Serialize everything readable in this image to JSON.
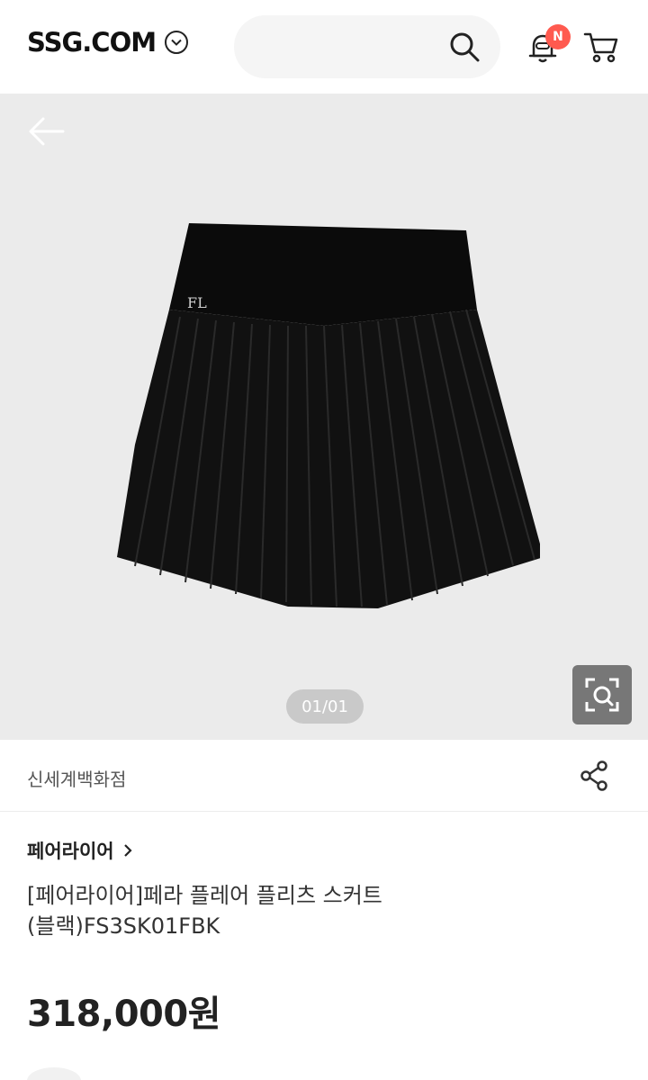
{
  "header": {
    "logo": "SSG.COM",
    "notification_badge": "N"
  },
  "gallery": {
    "counter": "01/01",
    "background": "#ebebeb"
  },
  "product": {
    "store": "신세계백화점",
    "brand": "페어라이어",
    "title_line1": "[페어라이어]페라 플레어 플리츠 스커트",
    "title_line2": "(블랙)FS3SK01FBK",
    "price": "318,000원"
  },
  "icons": [
    "chevron-down-icon",
    "search-icon",
    "bell-icon",
    "cart-icon",
    "back-arrow-icon",
    "lens-search-icon",
    "share-icon",
    "chevron-right-icon"
  ],
  "colors": {
    "badge": "#ff5a4f",
    "lens_button": "#777777"
  }
}
